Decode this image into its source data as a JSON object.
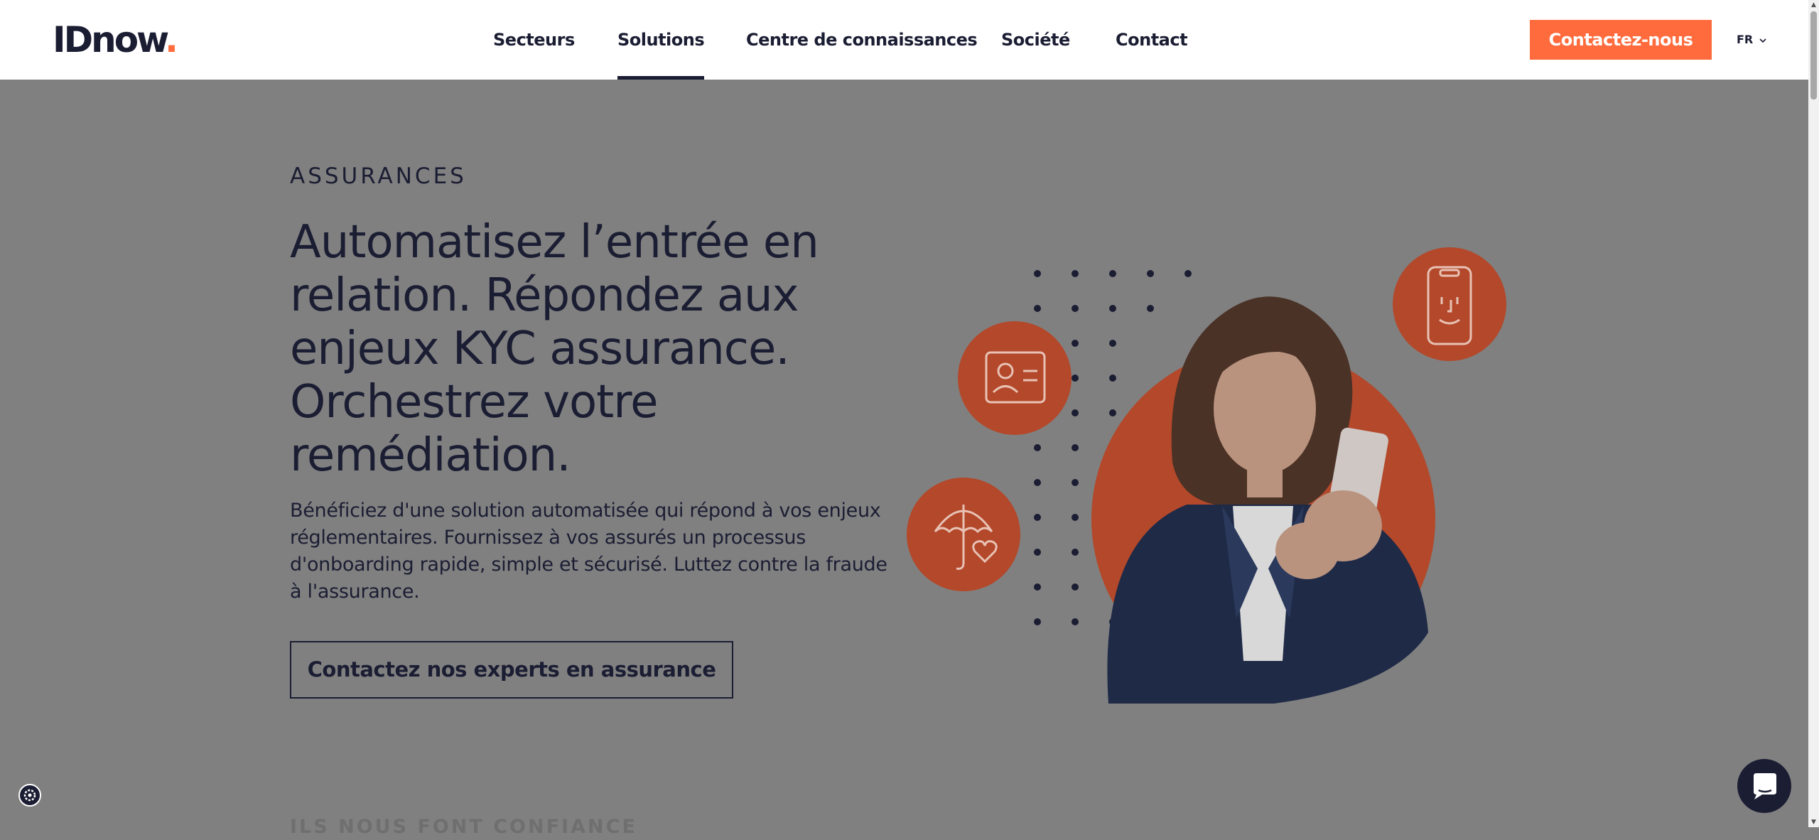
{
  "header": {
    "logo_text": "IDnow",
    "logo_dot": ".",
    "nav": [
      "Secteurs",
      "Solutions",
      "Centre de connaissances",
      "Société",
      "Contact"
    ],
    "active_nav": "Solutions",
    "cta_label": "Contactez-nous",
    "language": "FR"
  },
  "hero": {
    "eyebrow": "ASSURANCES",
    "headline": "Automatisez l’entrée en relation. Répondez aux enjeux KYC assurance. Orchestrez votre remédiation.",
    "lead": "Bénéficiez d'une solution automatisée qui répond à vos enjeux réglementaires. Fournissez à vos assurés un processus d'onboarding rapide, simple et sécurisé. Luttez contre la fraude à l'assurance.",
    "cta_label": "Contactez nos experts en assurance"
  },
  "trust_section": {
    "title": "ILS NOUS FONT CONFIANCE"
  },
  "icons": {
    "id_card": "id-card-icon",
    "umbrella_heart": "umbrella-heart-icon",
    "phone_face": "phone-face-icon",
    "cookie": "cookie-settings-icon",
    "chat": "chat-icon",
    "dropdown": "chevron-down-icon"
  },
  "colors": {
    "accent": "#ff6b3d",
    "accent_dim": "#b3482a",
    "navy": "#1b1d33",
    "overlay_gray": "#808080"
  }
}
